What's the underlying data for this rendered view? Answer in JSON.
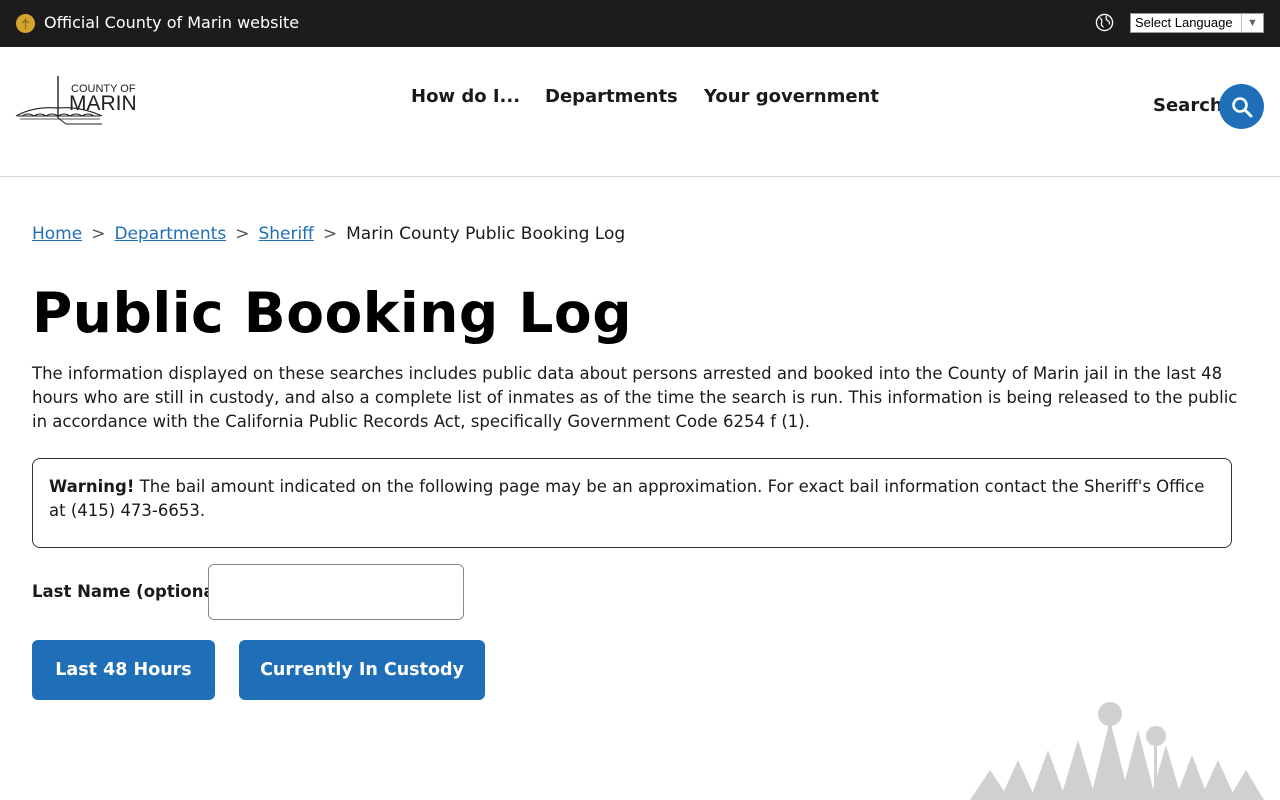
{
  "topbar": {
    "official_text": "Official County of Marin website",
    "language_select": "Select Language",
    "globe_icon": "globe-icon",
    "seal_icon": "county-seal-icon"
  },
  "header": {
    "logo_line1": "COUNTY OF",
    "logo_line2": "MARIN",
    "nav": [
      "How do I...",
      "Departments",
      "Your government"
    ],
    "search_label": "Search",
    "search_icon": "search-icon"
  },
  "breadcrumb": {
    "items": [
      "Home",
      "Departments",
      "Sheriff"
    ],
    "separator": ">",
    "current": "Marin County Public Booking Log"
  },
  "page": {
    "title": "Public Booking Log",
    "intro": "The information displayed on these searches includes public data about persons arrested and booked into the County of Marin jail in the last 48 hours who are still in custody, and also a complete list of inmates as of the time the search is run. This information is being released to the public in accordance with the California Public Records Act, specifically Government Code 6254 f (1).",
    "warning_label": "Warning!",
    "warning_text": " The bail amount indicated on the following page may be an approximation. For exact bail information contact the Sheriff's Office at (415) 473-6653."
  },
  "form": {
    "last_name_label": "Last Name (optional):",
    "last_name_value": "",
    "buttons": [
      "Last 48 Hours",
      "Currently In Custody"
    ]
  },
  "colors": {
    "topbar_bg": "#1c1c1c",
    "accent": "#1f6fb8",
    "seal": "#d4a52c"
  }
}
